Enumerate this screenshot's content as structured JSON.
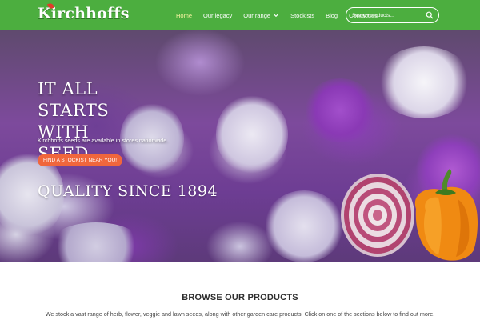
{
  "header": {
    "logo_text": "Kirchhoffs",
    "brand_color": "#4cae3f",
    "nav": [
      {
        "label": "Home",
        "active": true
      },
      {
        "label": "Our legacy"
      },
      {
        "label": "Our range",
        "has_dropdown": true
      },
      {
        "label": "Stockists"
      },
      {
        "label": "Blog"
      },
      {
        "label": "Contact us"
      }
    ],
    "search": {
      "placeholder": "Search products..."
    }
  },
  "hero": {
    "heading": "It all starts with seed",
    "subtext": "Kirchhoffs seeds are available in stores nationwide.",
    "cta_label": "FIND A STOCKIST NEAR YOU!",
    "cta_color": "#f0663c",
    "tagline": "Quality since 1894"
  },
  "products": {
    "title": "BROWSE OUR PRODUCTS",
    "description": "We stock a vast range of herb, flower, veggie and lawn seeds, along with other garden care products. Click on one of the sections below to find out more."
  }
}
